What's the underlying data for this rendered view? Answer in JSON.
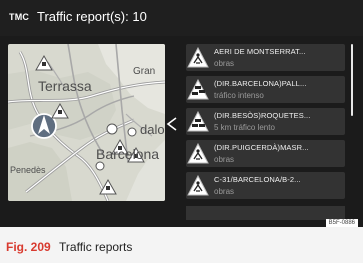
{
  "header": {
    "tmc_label": "TMC",
    "title": "Traffic report(s): 10"
  },
  "map": {
    "labels": {
      "terrassa": "Terrassa",
      "gran": "Gran",
      "barcelona": "Barcelona",
      "penedes": "Penedès",
      "dalo": "dalo"
    }
  },
  "reports": [
    {
      "title": "AERI DE MONTSERRAT...",
      "detail": "obras",
      "icon": "roadworks-icon"
    },
    {
      "title": "(DIR.BARCELONA)PALL...",
      "detail": "tráfico intenso",
      "icon": "traffic-jam-icon"
    },
    {
      "title": "(DIR.BESÒS)ROQUETES...",
      "detail": "5 km tráfico lento",
      "icon": "slow-traffic-icon"
    },
    {
      "title": "(DIR.PUIGCERDÀ)MASR...",
      "detail": "obras",
      "icon": "roadworks-icon"
    },
    {
      "title": "C-31/BARCELONA/B-2...",
      "detail": "obras",
      "icon": "roadworks-icon"
    }
  ],
  "figure_code": "B5F-0886",
  "caption": {
    "number": "Fig. 209",
    "text": "Traffic reports"
  },
  "colors": {
    "accent": "#d83a2f",
    "screen_bg": "#1b1b1b",
    "row_bg": "#333333",
    "map_bg": "#d8d9cf"
  }
}
